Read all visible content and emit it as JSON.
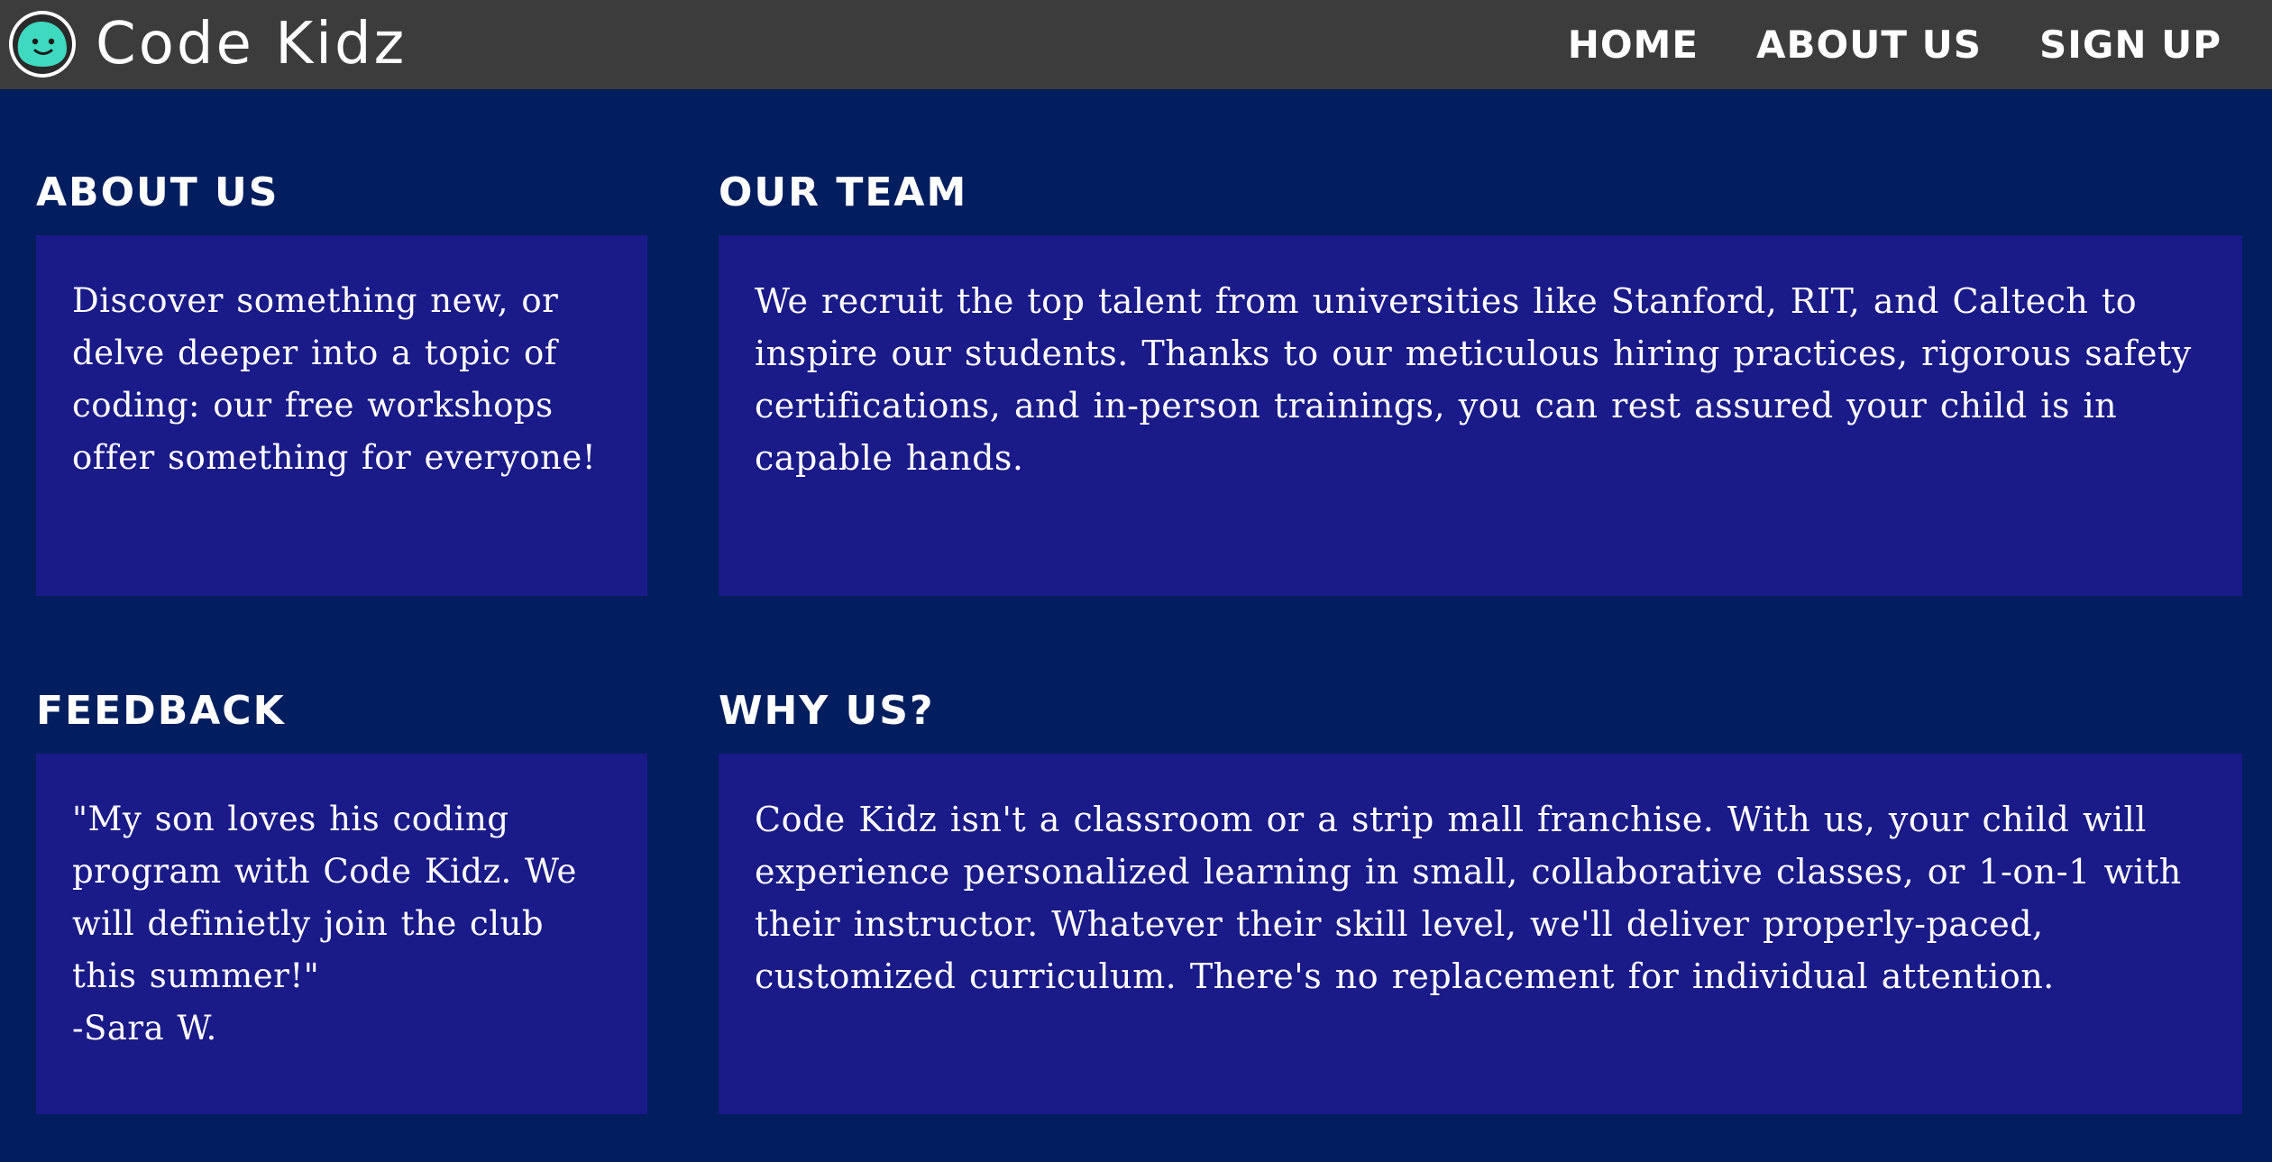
{
  "brand": {
    "name": "Code Kidz",
    "logo_icon": "smiling-blob-icon",
    "logo_color": "#3fd9c0"
  },
  "nav": {
    "items": [
      {
        "label": "HOME"
      },
      {
        "label": "ABOUT US"
      },
      {
        "label": "SIGN UP"
      }
    ]
  },
  "sections": {
    "about": {
      "heading": "ABOUT US",
      "body": "Discover something new, or delve deeper into a topic of coding: our free workshops offer something for everyone!"
    },
    "team": {
      "heading": "OUR TEAM",
      "body": "We recruit the top talent from universities like Stanford, RIT, and Caltech to inspire our students. Thanks to our meticulous hiring practices, rigorous safety certifications, and in-person trainings, you can rest assured your child is in capable hands."
    },
    "feedback": {
      "heading": "FEEDBACK",
      "quote": "\"My son loves his coding program with Code Kidz. We will definietly join the club this summer!\"",
      "author": "-Sara W."
    },
    "why": {
      "heading": "WHY US?",
      "body": "Code Kidz isn't a classroom or a strip mall franchise. With us, your child will experience personalized learning in small, collaborative classes, or 1-on-1 with their instructor. Whatever their skill level, we'll deliver properly-paced, customized curriculum. There's no replacement for individual attention."
    }
  },
  "colors": {
    "page_background": "#031e5e",
    "topbar_background": "#3c3c3c",
    "card_background": "#1a1a88",
    "text": "#ffffff"
  }
}
